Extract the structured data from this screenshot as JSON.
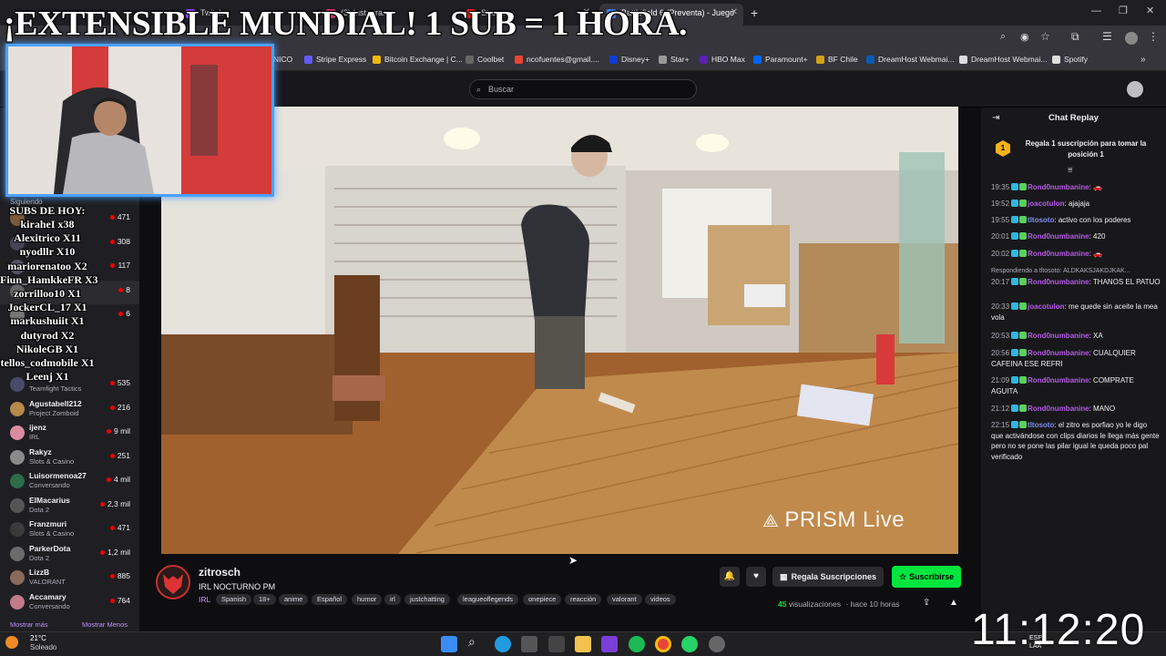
{
  "overlay": {
    "headline": "¡EXTENSIBLE MUNDIAL! 1 SUB = 1 HORA.",
    "subs_title": "SUBS DE HOY:",
    "subs": [
      "kiraheI x38",
      "Alexitrico X11",
      "nyodllr X10",
      "mariorenatoo X2",
      "Fiun_HamkkeFR X3",
      "zorrilloo10 X1",
      "JockerCL_17 X1",
      "markushuiit X1",
      "dutyrod X2",
      "NikoleGB X1",
      "tellos_codmobile X1",
      "Leenj X1"
    ],
    "clock": "11:12:20"
  },
  "browser": {
    "tabs": [
      {
        "label": "Twitch",
        "active": false,
        "color": "#9146ff"
      },
      {
        "label": "(3) Instagram",
        "active": false,
        "color": "#e1306c"
      },
      {
        "label": "Stream",
        "active": false,
        "color": "#e91916"
      },
      {
        "label": "Battlefield 6 (Preventa) - Juego",
        "active": true,
        "color": "#3b82f6"
      }
    ],
    "bookmarks": [
      {
        "label": "NICO",
        "color": "#888"
      },
      {
        "label": "Stripe Express",
        "color": "#635bff"
      },
      {
        "label": "Bitcoin Exchange | C...",
        "color": "#f0b90b"
      },
      {
        "label": "Coolbet",
        "color": "#444"
      },
      {
        "label": "ncofuentes@gmail....",
        "color": "#ea4335"
      },
      {
        "label": "Disney+",
        "color": "#113ccf"
      },
      {
        "label": "Star+",
        "color": "#888"
      },
      {
        "label": "HBO Max",
        "color": "#5822b4"
      },
      {
        "label": "Paramount+",
        "color": "#0064ff"
      },
      {
        "label": "BF Chile",
        "color": "#d4a017"
      },
      {
        "label": "DreamHost Webmai...",
        "color": "#0a5bb5"
      },
      {
        "label": "DreamHost Webmai...",
        "color": "#e0e0e0"
      },
      {
        "label": "Spotify",
        "color": "#e0e0e0"
      }
    ]
  },
  "search": {
    "placeholder": "Buscar"
  },
  "sidebar": {
    "following_label": "Siguiendo",
    "channels": [
      {
        "name": "",
        "game": "",
        "viewers": "471",
        "color": "#7d5a3a"
      },
      {
        "name": "",
        "game": "",
        "viewers": "308",
        "color": "#445"
      },
      {
        "name": "",
        "game": "",
        "viewers": "117",
        "color": "#556"
      },
      {
        "name": "",
        "game": "",
        "viewers": "8",
        "color": "#666"
      },
      {
        "name": "",
        "game": "",
        "viewers": "6",
        "color": "#777"
      },
      {
        "name": "",
        "game": "Teamfight Tactics",
        "viewers": "535",
        "color": "#4a4a6a"
      },
      {
        "name": "Agustabell212",
        "game": "Project Zomboid",
        "viewers": "216",
        "color": "#b58a4a"
      },
      {
        "name": "ijenz",
        "game": "IRL",
        "viewers": "9 mil",
        "color": "#d98ca0"
      },
      {
        "name": "Rakyz",
        "game": "Slots & Casino",
        "viewers": "251",
        "color": "#8a8a8a"
      },
      {
        "name": "Luisormenoa27",
        "game": "Conversando",
        "viewers": "4 mil",
        "color": "#2e6b4a"
      },
      {
        "name": "ElMacarius",
        "game": "Dota 2",
        "viewers": "2,3 mil",
        "color": "#555"
      },
      {
        "name": "Franzmuri",
        "game": "Slots & Casino",
        "viewers": "471",
        "color": "#3a3a3a"
      },
      {
        "name": "ParkerDota",
        "game": "Dota 2",
        "viewers": "1,2 mil",
        "color": "#6b6b6b"
      },
      {
        "name": "LizzB",
        "game": "VALORANT",
        "viewers": "885",
        "color": "#8a6a5a"
      },
      {
        "name": "Accamary",
        "game": "Conversando",
        "viewers": "764",
        "color": "#c07a8a"
      }
    ],
    "show_more": "Mostrar más",
    "show_less": "Mostrar Menos"
  },
  "video": {
    "watermark": "PRISM Live"
  },
  "chat": {
    "title": "Chat Replay",
    "pinned": {
      "rank": "1",
      "text": "Regala 1 suscripción para tomar la posición 1"
    },
    "messages": [
      {
        "time": "19:35",
        "user": "Rond0numbanine",
        "color": "#b65ae6",
        "text": ""
      },
      {
        "time": "19:52",
        "user": "joacotulon",
        "color": "#b65ae6",
        "text": "ajajaja"
      },
      {
        "time": "19:55",
        "user": "tltosoto",
        "color": "#7f8cf0",
        "text": "activo con los poderes"
      },
      {
        "time": "20:01",
        "user": "Rond0numbanine",
        "color": "#b65ae6",
        "text": "420"
      },
      {
        "time": "20:02",
        "user": "Rond0numbanine",
        "color": "#b65ae6",
        "text": ""
      },
      {
        "time": "20:17",
        "user": "Rond0numbanine",
        "color": "#b65ae6",
        "text": "THANOS EL PATUO",
        "reply": "Respondiendo a tltosoto: ALDKAKSJAKDJKAK..."
      },
      {
        "time": "20:33",
        "user": "joacotulon",
        "color": "#b65ae6",
        "text": "me quede sin aceite la mea vola"
      },
      {
        "time": "20:53",
        "user": "Rond0numbanine",
        "color": "#b65ae6",
        "text": "XA"
      },
      {
        "time": "20:56",
        "user": "Rond0numbanine",
        "color": "#b65ae6",
        "text": "CUALQUIER CAFEINA ESE REFRI"
      },
      {
        "time": "21:09",
        "user": "Rond0numbanine",
        "color": "#b65ae6",
        "text": "COMPRATE AGUITA"
      },
      {
        "time": "21:12",
        "user": "Rond0numbanine",
        "color": "#b65ae6",
        "text": "MANO"
      },
      {
        "time": "22:15",
        "user": "tltosoto",
        "color": "#7f8cf0",
        "text": "el zitro es porfiao yo le digo que activándose con clips diarios le llega más gente pero no se pone las pilar igual le queda poco pal verificado"
      }
    ]
  },
  "stream": {
    "channel": "zitrosch",
    "title": "IRL NOCTURNO PM",
    "category": "IRL",
    "tags": [
      "Spanish",
      "18+",
      "anime",
      "Español",
      "humor",
      "irl",
      "justchatting",
      "leagueoflegends",
      "onepiece",
      "reacción",
      "valorant",
      "videos"
    ],
    "gift_label": "Regala Suscripciones",
    "subscribe_label": "Suscribirse",
    "views_count": "45",
    "views_word": "visualizaciones",
    "ago": "hace 10 horas"
  },
  "taskbar": {
    "temp": "21°C",
    "weather": "Soleado",
    "lang1": "ESP",
    "lang2": "LAA"
  }
}
